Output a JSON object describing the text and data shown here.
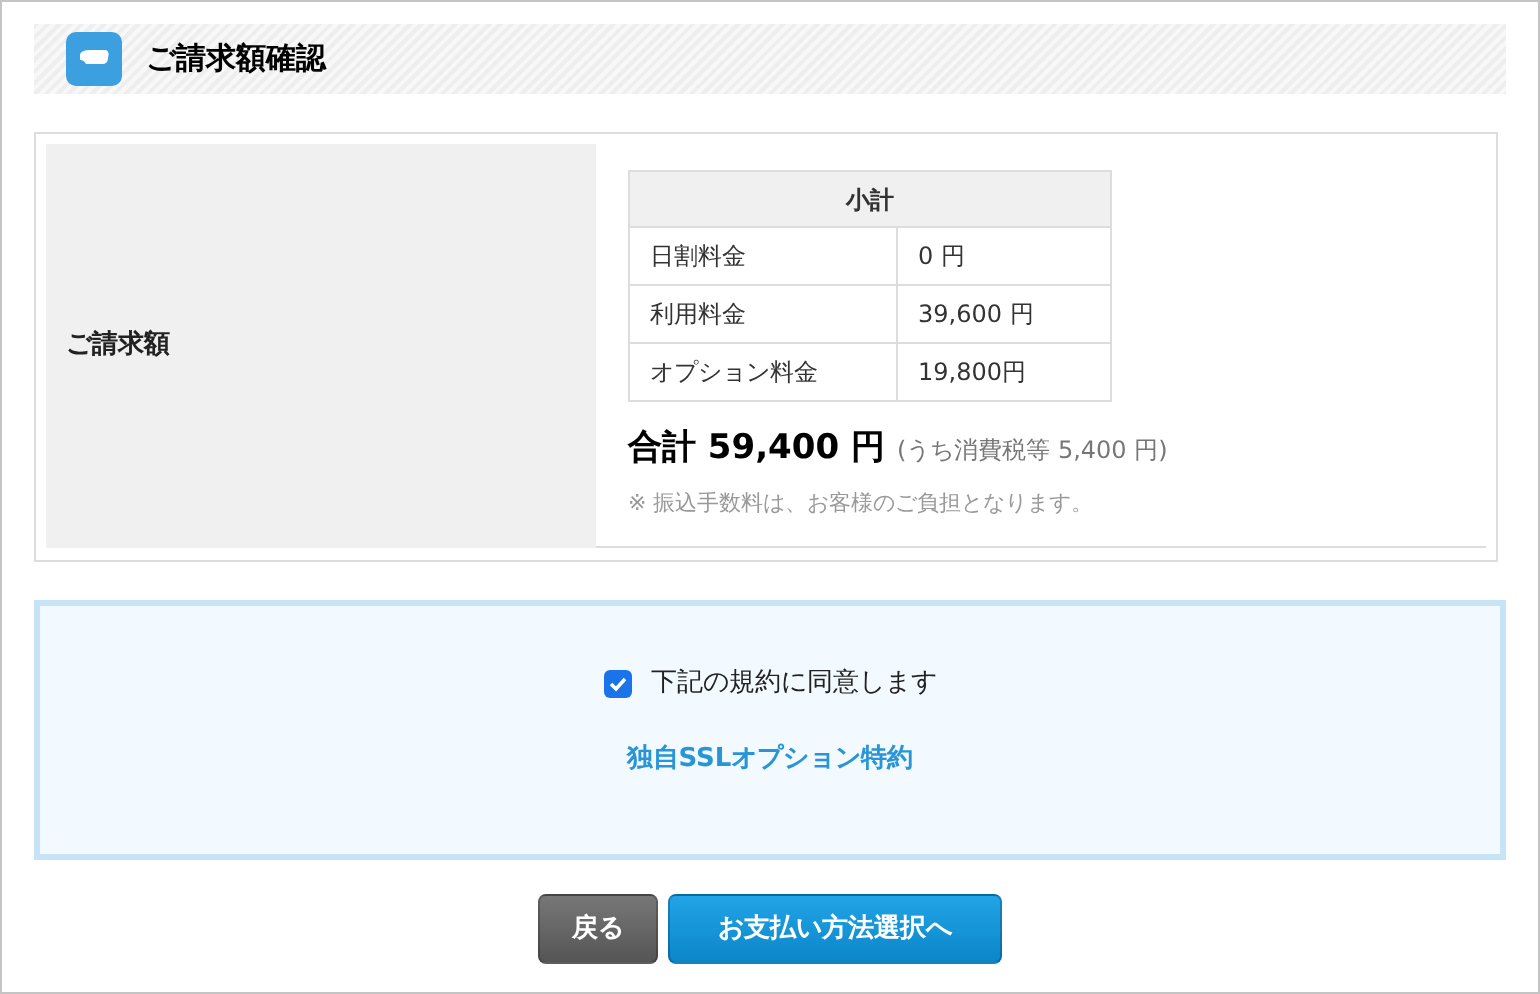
{
  "section_title": "ご請求額確認",
  "billing": {
    "label": "ご請求額",
    "subtotal_table": {
      "header": "小計",
      "rows": [
        {
          "item": "日割料金",
          "amount": "0 円"
        },
        {
          "item": "利用料金",
          "amount": "39,600 円"
        },
        {
          "item": "オプション料金",
          "amount": "19,800円"
        }
      ]
    },
    "total": "合計 59,400 円",
    "tax_note": "(うち消費税等 5,400 円)",
    "fee_note": "※ 振込手数料は、お客様のご負担となります。"
  },
  "agreement": {
    "checked": true,
    "label": "下記の規約に同意します",
    "link": "独自SSLオプション特約"
  },
  "buttons": [
    {
      "kind": "back",
      "label": "戻る"
    },
    {
      "kind": "primary",
      "label": "お支払い方法選択へ"
    }
  ]
}
